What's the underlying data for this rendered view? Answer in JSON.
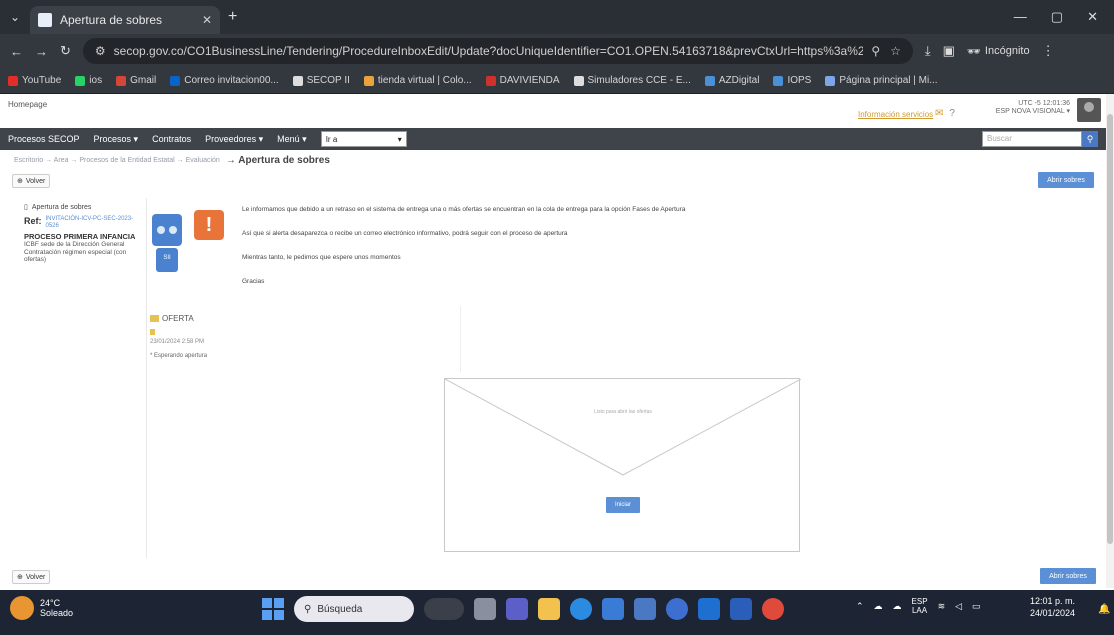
{
  "browser": {
    "tab_title": "Apertura de sobres",
    "url": "secop.gov.co/CO1BusinessLine/Tendering/ProcedureInboxEdit/Update?docUniqueIdentifier=CO1.OPEN.54163718&prevCtxUrl=https%3a%2f%2fw...",
    "incognito_label": "Incógnito"
  },
  "bookmarks": [
    {
      "label": "YouTube",
      "color": "#e52d27"
    },
    {
      "label": "ios",
      "color": "#25d366"
    },
    {
      "label": "Gmail",
      "color": "#d44638"
    },
    {
      "label": "Correo invitacion00...",
      "color": "#0a64c8"
    },
    {
      "label": "SECOP II",
      "color": "#dddddd"
    },
    {
      "label": "tienda virtual | Colo...",
      "color": "#e8a33a"
    },
    {
      "label": "DAVIVIENDA",
      "color": "#d0312d"
    },
    {
      "label": "Simuladores CCE - E...",
      "color": "#dddddd"
    },
    {
      "label": "AZDigital",
      "color": "#4a90d9"
    },
    {
      "label": "IOPS",
      "color": "#4a90d9"
    },
    {
      "label": "Página principal | Mi...",
      "color": "#7aa7e8"
    }
  ],
  "header": {
    "logo_alt": "Homepage",
    "user_time": "UTC -5 12:01:36",
    "user_name": "ESP NOVA VISIONAL ▾",
    "link_text": "Información servicios"
  },
  "nav": {
    "items": [
      "Procesos SECOP",
      "Procesos ▾",
      "Contratos",
      "Proveedores ▾",
      "Menú ▾"
    ],
    "select_value": "Ir a",
    "search_placeholder": "Buscar"
  },
  "breadcrumb": {
    "items": [
      "Escritorio → Area → Procesos de la Entidad Estatal → Evaluación"
    ],
    "current": "→ Apertura de sobres"
  },
  "buttons": {
    "volver": "Volver",
    "abrir_sobres": "Abrir sobres",
    "iniciar": "Iniciar"
  },
  "left_panel": {
    "title": "Apertura de sobres",
    "ref_label": "Ref:",
    "ref_value": "INVITACIÓN-ICV-PC-SEC-2023-0526",
    "process": "PROCESO PRIMERA INFANCIA",
    "desc": "ICBF sede de la Dirección General Contratación régimen especial (con ofertas)"
  },
  "robot": {
    "badge_text": "!",
    "body_text": "SII"
  },
  "messages": [
    "Le informamos que debido a un retraso en el sistema de entrega una o más ofertas se encuentran en la cola de entrega para la opción Fases de Apertura",
    "Así que si alerta desaparezca o recibe un correo electrónico informativo, podrá seguir con el proceso de apertura",
    "Mientras tanto, le pedimos que espere unos momentos",
    "Gracias"
  ],
  "oferta": {
    "title": "OFERTA",
    "date": "23/01/2024 2:58 PM",
    "status": "* Esperando apertura"
  },
  "envelope": {
    "text": "Listo para abrir las ofertas"
  },
  "taskbar": {
    "temperature": "24°C",
    "weather": "Soleado",
    "search_placeholder": "Búsqueda",
    "lang_top": "ESP",
    "lang_bottom": "LAA",
    "time": "12:01 p. m.",
    "date": "24/01/2024"
  }
}
